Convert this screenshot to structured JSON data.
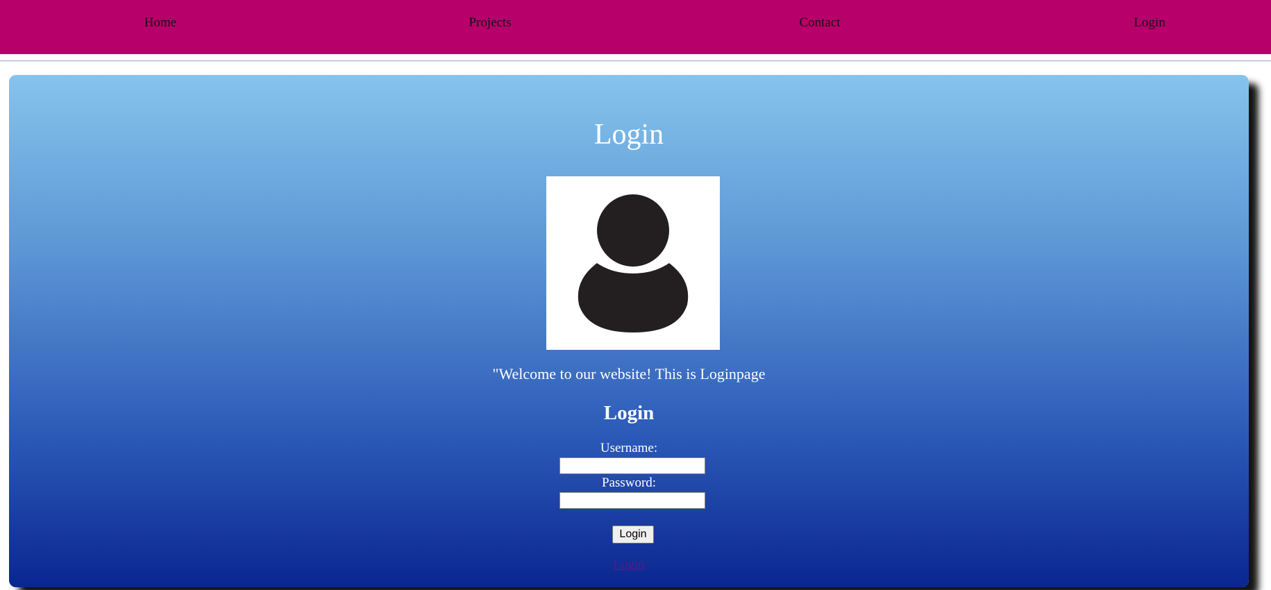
{
  "nav": {
    "items": [
      {
        "label": "Home"
      },
      {
        "label": "Projects"
      },
      {
        "label": "Contact"
      },
      {
        "label": "Login"
      }
    ],
    "background": "#b8006b"
  },
  "main": {
    "title": "Login",
    "avatar_icon": "user-silhouette-icon",
    "welcome_text": "\"Welcome to our website! This is Loginpage",
    "form": {
      "title": "Login",
      "username_label": "Username:",
      "username_value": "",
      "password_label": "Password:",
      "password_value": "",
      "submit_label": "Login"
    },
    "footer_link": "Login"
  },
  "colors": {
    "gradient_top": "#86c4ec",
    "gradient_bottom": "#0a2690",
    "visited_link": "#551a8b"
  }
}
